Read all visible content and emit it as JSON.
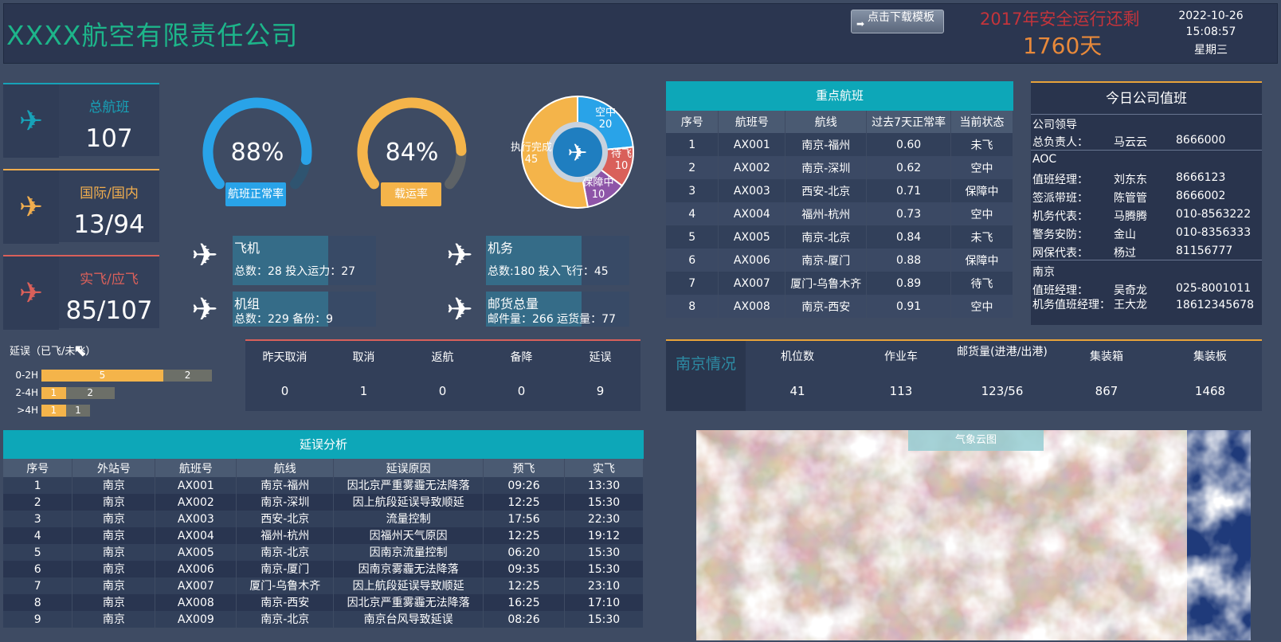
{
  "header": {
    "title": "XXXX航空有限责任公司",
    "download_label": "点击下载模板",
    "safety_label": "2017年安全运行还剩",
    "safety_days": "1760天",
    "date": "2022-10-26",
    "time": "15:08:57",
    "weekday": "星期三"
  },
  "kpis": [
    {
      "label": "总航班",
      "value": "107",
      "color": "#17a2b8"
    },
    {
      "label": "国际/国内",
      "value": "13/94",
      "color": "#f0ad4e"
    },
    {
      "label": "实飞/应飞",
      "value": "85/107",
      "color": "#d9605a"
    }
  ],
  "gauges": [
    {
      "value_text": "88%",
      "value": 0.88,
      "label": "航班正常率",
      "color": "#29a3e8"
    },
    {
      "value_text": "84%",
      "value": 0.84,
      "label": "载运率",
      "color": "#f4b44a"
    }
  ],
  "status_pie": {
    "slices": [
      {
        "name": "空中",
        "value": 20,
        "color": "#29a3e8"
      },
      {
        "name": "待飞",
        "value": 10,
        "color": "#d9605a"
      },
      {
        "name": "保障中",
        "value": 10,
        "color": "#8e55a8"
      },
      {
        "name": "执行完成",
        "value": 45,
        "color": "#f4b44a"
      }
    ]
  },
  "resources": [
    {
      "title": "飞机",
      "detail": "总数：28   投入运力：27"
    },
    {
      "title": "机务",
      "detail": "总数:180  投入飞行：45"
    },
    {
      "title": "机组",
      "detail": "总数：229    备份：9"
    },
    {
      "title": "邮货总量",
      "detail": "邮件量：266   运货量：77"
    }
  ],
  "key_flights": {
    "title": "重点航班",
    "columns": [
      "序号",
      "航班号",
      "航线",
      "过去7天正常率",
      "当前状态"
    ],
    "rows": [
      [
        "1",
        "AX001",
        "南京-福州",
        "0.60",
        "未飞"
      ],
      [
        "2",
        "AX002",
        "南京-深圳",
        "0.62",
        "空中"
      ],
      [
        "3",
        "AX003",
        "西安-北京",
        "0.71",
        "保障中"
      ],
      [
        "4",
        "AX004",
        "福州-杭州",
        "0.73",
        "空中"
      ],
      [
        "5",
        "AX005",
        "南京-北京",
        "0.84",
        "未飞"
      ],
      [
        "6",
        "AX006",
        "南京-厦门",
        "0.88",
        "保障中"
      ],
      [
        "7",
        "AX007",
        "厦门-乌鲁木齐",
        "0.89",
        "待飞"
      ],
      [
        "8",
        "AX008",
        "南京-西安",
        "0.91",
        "空中"
      ]
    ]
  },
  "duty": {
    "title": "今日公司值班",
    "rows": [
      [
        "公司领导",
        "",
        ""
      ],
      [
        "总负责人：",
        "马云云",
        "8666000"
      ],
      [
        "AOC",
        "",
        ""
      ],
      [
        "值班经理：",
        "刘东东",
        "8666123"
      ],
      [
        "签派带班：",
        "陈管管",
        "8666002"
      ],
      [
        "机务代表：",
        "马腾腾",
        "010-8563222"
      ],
      [
        "警务安防：",
        "金山",
        "010-8356333"
      ],
      [
        "网保代表：",
        "杨过",
        "81156777"
      ],
      [
        "南京",
        "",
        ""
      ],
      [
        "值班经理：",
        "吴奇龙",
        "025-8001011"
      ],
      [
        "机务值班经理：",
        "王大龙",
        "18612345678"
      ]
    ]
  },
  "delay_bars": {
    "title": "延误（已飞/未飞）",
    "rows": [
      {
        "label": "0-2H",
        "flown": 5,
        "unflown": 2
      },
      {
        "label": "2-4H",
        "flown": 1,
        "unflown": 2
      },
      {
        "label": ">4H",
        "flown": 1,
        "unflown": 1
      }
    ]
  },
  "cancel_stats": {
    "labels": [
      "昨天取消",
      "取消",
      "返航",
      "备降",
      "延误"
    ],
    "values": [
      "0",
      "1",
      "0",
      "0",
      "9"
    ]
  },
  "nanjing": {
    "side": "南京情况",
    "labels": [
      "机位数",
      "作业车",
      "邮货量(进港/出港)",
      "集装箱",
      "集装板"
    ],
    "values": [
      "41",
      "113",
      "123/56",
      "867",
      "1468"
    ]
  },
  "delay_analysis": {
    "title": "延误分析",
    "columns": [
      "序号",
      "外站号",
      "航班号",
      "航线",
      "延误原因",
      "预飞",
      "实飞"
    ],
    "rows": [
      [
        "1",
        "南京",
        "AX001",
        "南京-福州",
        "因北京严重雾霾无法降落",
        "09:26",
        "13:30"
      ],
      [
        "2",
        "南京",
        "AX002",
        "南京-深圳",
        "因上航段延误导致顺延",
        "12:25",
        "15:30"
      ],
      [
        "3",
        "南京",
        "AX003",
        "西安-北京",
        "流量控制",
        "17:56",
        "22:30"
      ],
      [
        "4",
        "南京",
        "AX004",
        "福州-杭州",
        "因福州天气原因",
        "12:25",
        "19:12"
      ],
      [
        "5",
        "南京",
        "AX005",
        "南京-北京",
        "因南京流量控制",
        "06:20",
        "15:30"
      ],
      [
        "6",
        "南京",
        "AX006",
        "南京-厦门",
        "因南京雾霾无法降落",
        "09:35",
        "15:30"
      ],
      [
        "7",
        "南京",
        "AX007",
        "厦门-乌鲁木齐",
        "因上航段延误导致顺延",
        "12:25",
        "23:10"
      ],
      [
        "8",
        "南京",
        "AX008",
        "南京-西安",
        "因北京严重雾霾无法降落",
        "16:25",
        "17:10"
      ],
      [
        "9",
        "南京",
        "AX009",
        "南京-北京",
        "南京台风导致延误",
        "08:26",
        "15:30"
      ]
    ]
  },
  "weather": {
    "label": "气象云图"
  }
}
